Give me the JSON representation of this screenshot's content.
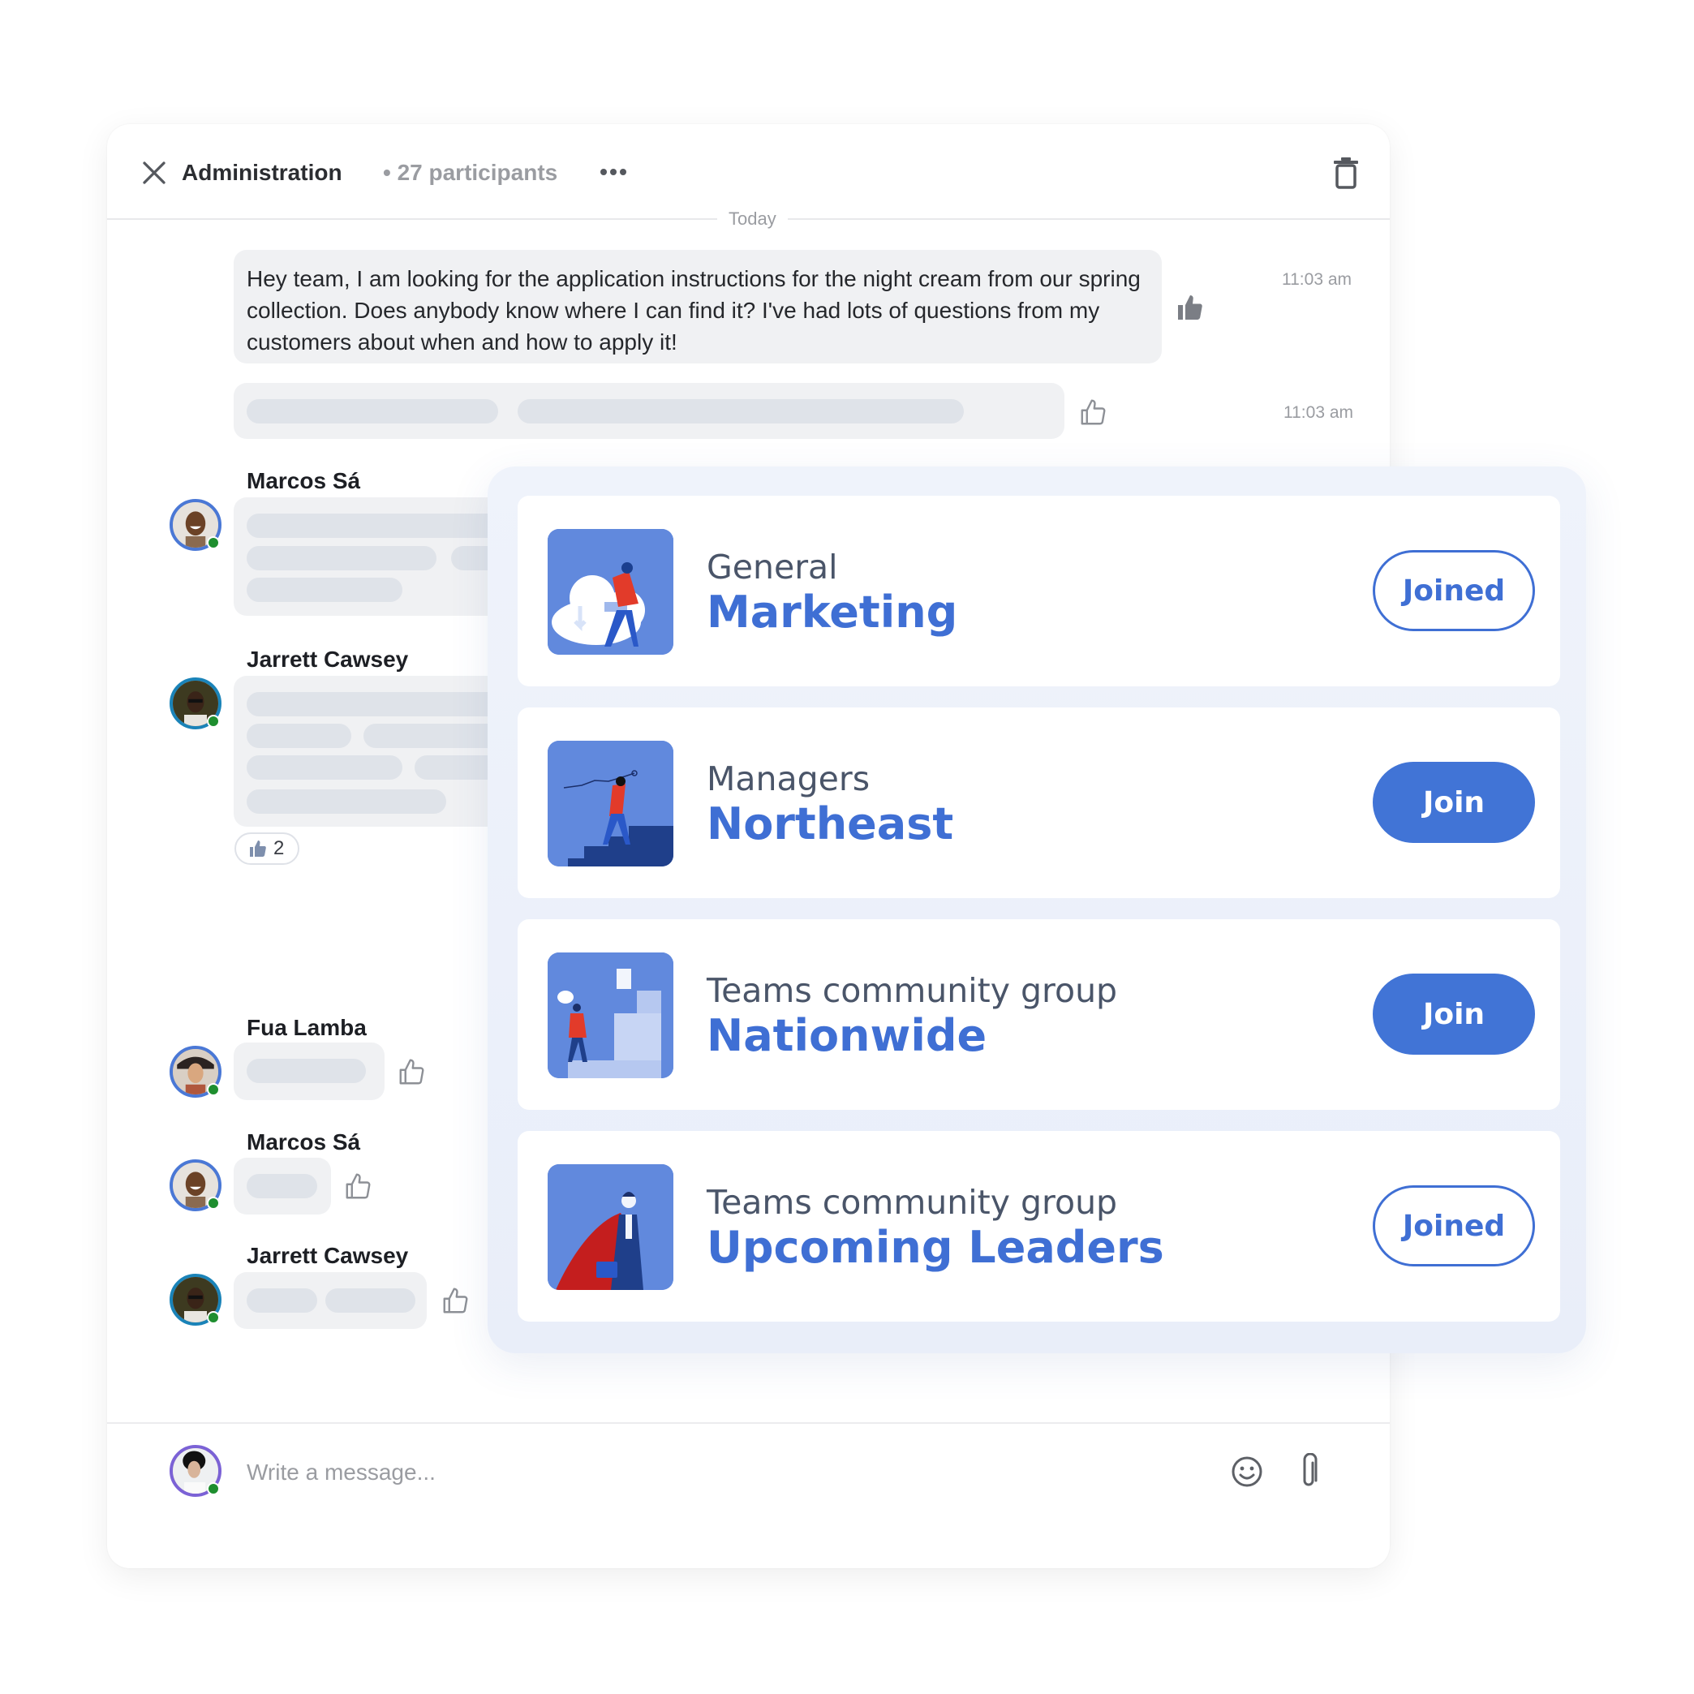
{
  "chat": {
    "title": "Administration",
    "participants": "• 27 participants",
    "date_divider": "Today",
    "messages": [
      {
        "text": "Hey team, I am looking for the application instructions for the night cream from our spring collection. Does anybody know where I can find it? I've had lots of questions from my customers about when and how to apply it!",
        "time": "11:03 am",
        "liked": true
      },
      {
        "text": "",
        "time": "11:03 am",
        "liked": false
      },
      {
        "sender": "Marcos Sá"
      },
      {
        "sender": "Jarrett Cawsey",
        "reaction": {
          "icon": "thumbs-up-icon",
          "count": "2"
        }
      },
      {
        "sender": "Fua Lamba"
      },
      {
        "sender": "Marcos Sá"
      },
      {
        "sender": "Jarrett Cawsey"
      }
    ],
    "input": {
      "placeholder": "Write a message..."
    }
  },
  "groups": [
    {
      "subtitle": "General",
      "title": "Marketing",
      "button": "Joined",
      "status": "joined"
    },
    {
      "subtitle": "Managers",
      "title": "Northeast",
      "button": "Join",
      "status": "not-joined"
    },
    {
      "subtitle": "Teams community group",
      "title": "Nationwide",
      "button": "Join",
      "status": "not-joined"
    },
    {
      "subtitle": "Teams community group",
      "title": "Upcoming Leaders",
      "button": "Joined",
      "status": "joined"
    }
  ],
  "colors": {
    "accent": "#4174d6",
    "presence": "#1e8e2f",
    "bubble": "#f0f1f3",
    "skeleton": "#dfe3e9"
  }
}
